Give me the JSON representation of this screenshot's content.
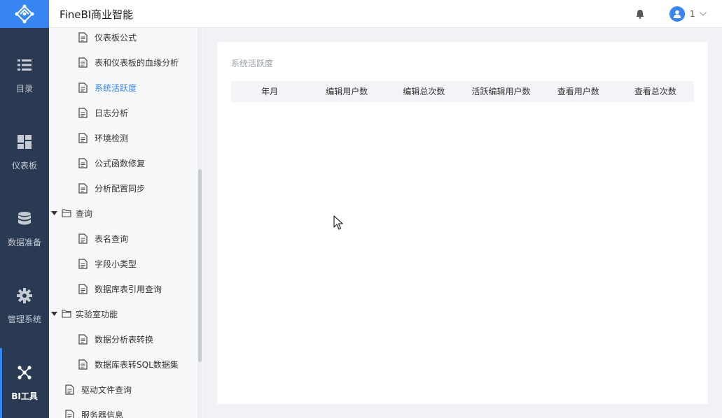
{
  "app": {
    "title": "FineBI商业智能"
  },
  "header": {
    "user_name": "1"
  },
  "rail": {
    "items": [
      {
        "label": "目录",
        "icon": "list-icon"
      },
      {
        "label": "仪表板",
        "icon": "dashboard-icon"
      },
      {
        "label": "数据准备",
        "icon": "database-icon"
      },
      {
        "label": "管理系统",
        "icon": "gear-icon"
      },
      {
        "label": "BI工具",
        "icon": "network-icon"
      }
    ],
    "active_index": 4
  },
  "tree": {
    "items": [
      {
        "label": "仪表板公式",
        "type": "file"
      },
      {
        "label": "表和仪表板的血缘分析",
        "type": "file"
      },
      {
        "label": "系统活跃度",
        "type": "file",
        "selected": true
      },
      {
        "label": "日志分析",
        "type": "file"
      },
      {
        "label": "环境检测",
        "type": "file"
      },
      {
        "label": "公式函数修复",
        "type": "file"
      },
      {
        "label": "分析配置同步",
        "type": "file"
      },
      {
        "label": "查询",
        "type": "folder"
      },
      {
        "label": "表名查询",
        "type": "file"
      },
      {
        "label": "字段小类型",
        "type": "file"
      },
      {
        "label": "数据库表引用查询",
        "type": "file"
      },
      {
        "label": "实验室功能",
        "type": "folder"
      },
      {
        "label": "数据分析表转换",
        "type": "file"
      },
      {
        "label": "数据库表转SQL数据集",
        "type": "file"
      },
      {
        "label": "驱动文件查询",
        "type": "file"
      },
      {
        "label": "服务器信息",
        "type": "file"
      }
    ]
  },
  "main": {
    "title": "系统活跃度",
    "columns": [
      "年月",
      "编辑用户数",
      "编辑总次数",
      "活跃编辑用户数",
      "查看用户数",
      "查看总次数"
    ]
  },
  "colors": {
    "accent": "#3685f2",
    "rail_bg": "#2b3a53",
    "tree_bg": "#f7f8fa"
  }
}
